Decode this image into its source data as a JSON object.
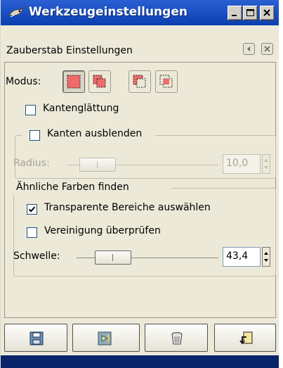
{
  "window": {
    "title": "Werkzeugeinstellungen",
    "icon": "gimp-wilber-icon",
    "controls": [
      "minimize-icon",
      "maximize-icon",
      "close-icon"
    ]
  },
  "panel": {
    "title": "Zauberstab Einstellungen",
    "header_buttons": [
      "menu-arrow-icon",
      "close-icon"
    ]
  },
  "modus": {
    "label": "Modus:",
    "modes": [
      {
        "icon": "replace-selection-icon",
        "active": true
      },
      {
        "icon": "add-selection-icon",
        "active": false
      },
      {
        "icon": "subtract-selection-icon",
        "active": false
      },
      {
        "icon": "intersect-selection-icon",
        "active": false
      }
    ]
  },
  "antialias": {
    "label": "Kantenglättung",
    "checked": false
  },
  "feather": {
    "label": "Kanten ausblenden",
    "checked": false,
    "radius_label": "Radius:",
    "radius_value": "10,0",
    "radius_fraction": 0.0,
    "enabled": false
  },
  "similar": {
    "group_label": "Ähnliche Farben finden",
    "transparent": {
      "label": "Transparente Bereiche auswählen",
      "checked": true
    },
    "merged": {
      "label": "Vereinigung überprüfen",
      "checked": false
    },
    "threshold_label": "Schwelle:",
    "threshold_value": "43,4"
  },
  "bottom_buttons": [
    {
      "icon": "save-icon"
    },
    {
      "icon": "restore-icon"
    },
    {
      "icon": "delete-icon"
    },
    {
      "icon": "reset-icon"
    }
  ],
  "colors": {
    "titlebar": "#0a3fb0",
    "background": "#ece9d8",
    "mode_red": "#f06a6a"
  }
}
